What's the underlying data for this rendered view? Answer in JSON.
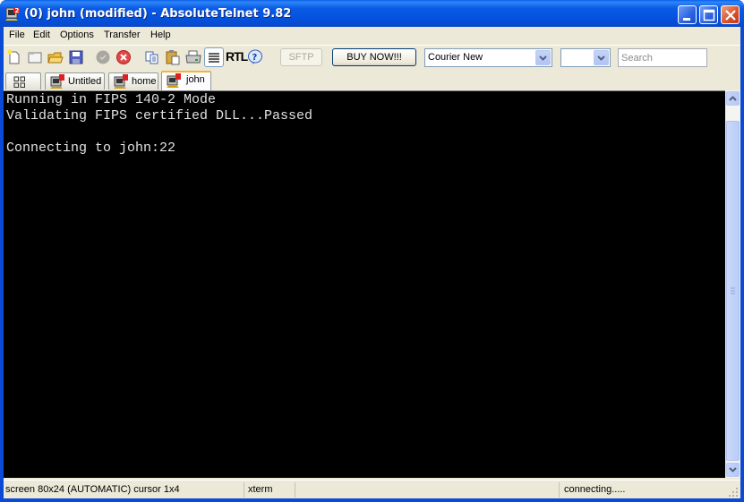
{
  "window": {
    "title": "(0) john (modified) - AbsoluteTelnet 9.82",
    "controls": [
      "minimize",
      "maximize",
      "close"
    ]
  },
  "menu": {
    "items": [
      "File",
      "Edit",
      "Options",
      "Transfer",
      "Help"
    ]
  },
  "toolbar": {
    "icons": [
      "new-file-icon",
      "new-window-icon",
      "open-folder-icon",
      "save-icon",
      "connect-icon",
      "disconnect-icon",
      "copy-icon",
      "paste-icon",
      "print-icon",
      "wrap-text-icon",
      "rtl-icon",
      "help-icon"
    ],
    "rtl_label": "RTL",
    "sftp_label": "SFTP",
    "buy_label": "BUY NOW!!!",
    "font_select": "Courier New",
    "size_select": "",
    "search_placeholder": "Search"
  },
  "tabs": [
    {
      "label": "",
      "icon": "grid-icon",
      "active": false
    },
    {
      "label": "Untitled",
      "active": false
    },
    {
      "label": "home",
      "active": false
    },
    {
      "label": "john",
      "active": true
    }
  ],
  "terminal": {
    "lines": [
      "Running in FIPS 140-2 Mode",
      "Validating FIPS certified DLL...Passed",
      "",
      "Connecting to john:22"
    ],
    "background": "#000000",
    "foreground": "#e0e0e0"
  },
  "status": {
    "screen": "screen 80x24 (AUTOMATIC) cursor 1x4",
    "emulation": "xterm",
    "middle": "",
    "connection": "connecting....."
  }
}
